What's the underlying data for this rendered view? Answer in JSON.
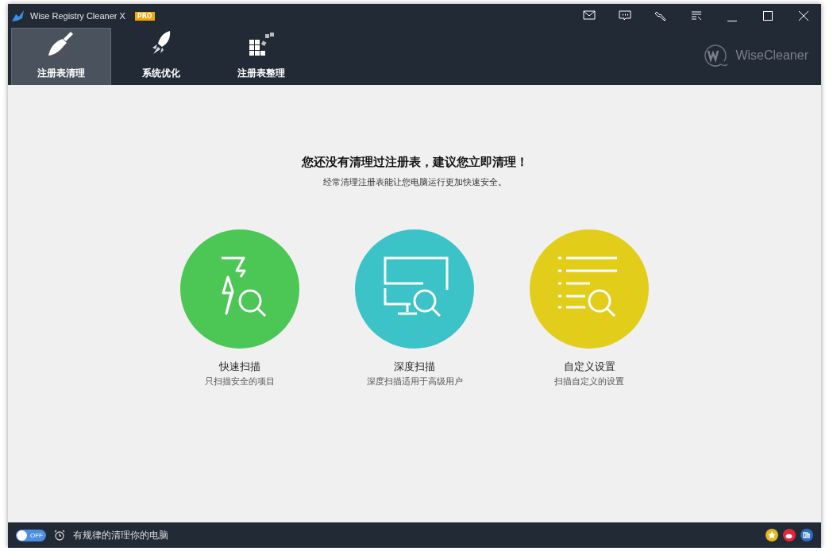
{
  "window": {
    "title": "Wise Registry Cleaner X",
    "badge": "PRO",
    "brand": "WiseCleaner"
  },
  "tabs": [
    {
      "label": "注册表清理",
      "kind": "broom",
      "selected": true
    },
    {
      "label": "系统优化",
      "kind": "rocket",
      "selected": false
    },
    {
      "label": "注册表整理",
      "kind": "blocks",
      "selected": false
    }
  ],
  "main": {
    "heading": "您还没有清理过注册表，建议您立即清理！",
    "subheading": "经常清理注册表能让您电脑运行更加快速安全。"
  },
  "scans": [
    {
      "title": "快速扫描",
      "description": "只扫描安全的项目",
      "kind": "fast",
      "color": "#4cc655"
    },
    {
      "title": "深度扫描",
      "description": "深度扫描适用于高级用户",
      "kind": "deep",
      "color": "#3bc3c8"
    },
    {
      "title": "自定义设置",
      "description": "扫描自定义的设置",
      "kind": "custom",
      "color": "#e2cd1a"
    }
  ],
  "status_bar": {
    "schedule_toggle": {
      "label": "OFF",
      "on": false
    },
    "schedule_text": "有规律的清理你的电脑"
  }
}
